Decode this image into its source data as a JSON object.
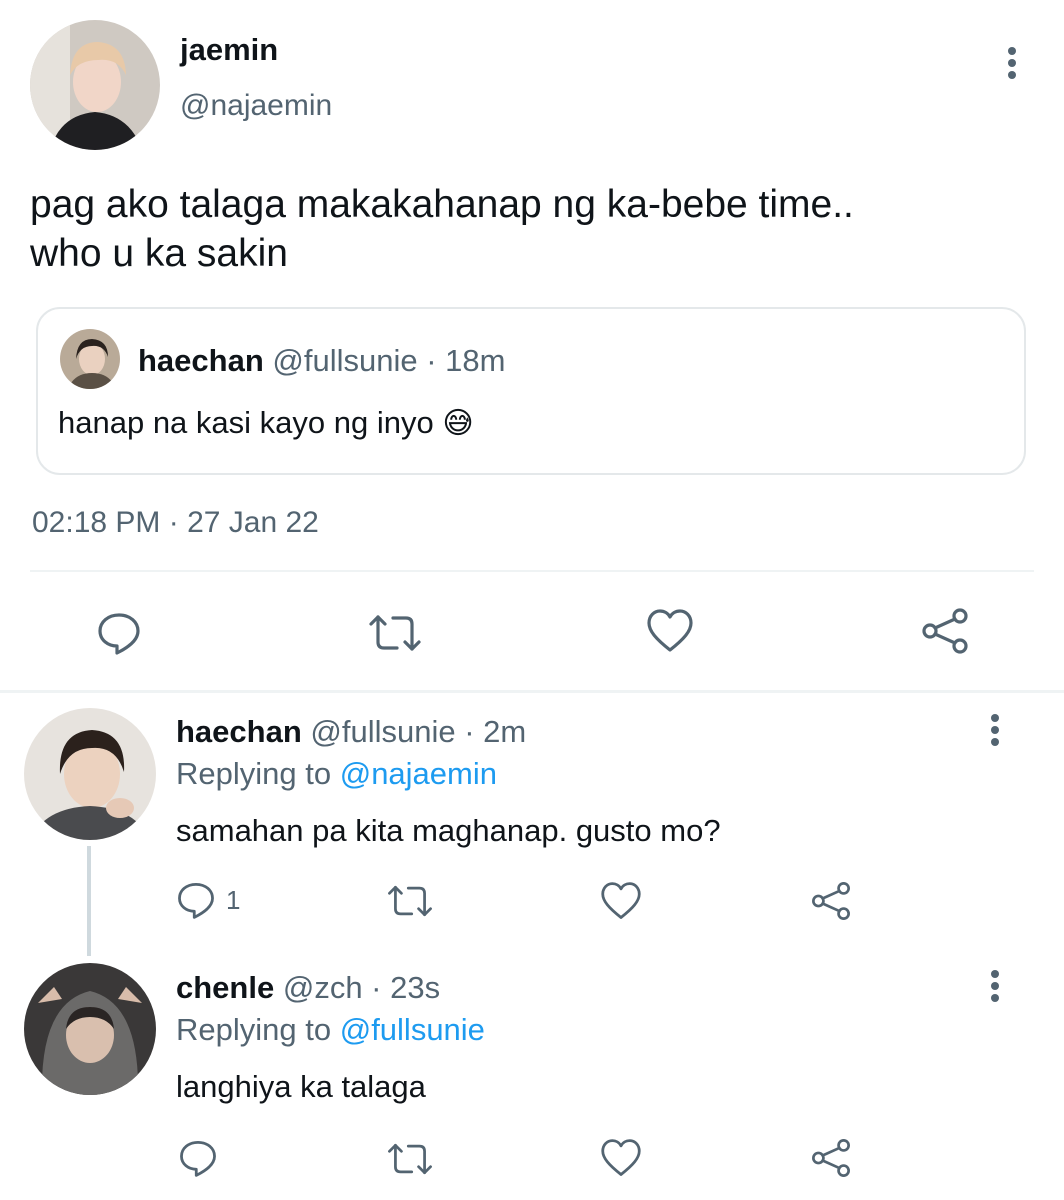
{
  "main_tweet": {
    "display_name": "jaemin",
    "handle": "@najaemin",
    "text_line1": "pag ako talaga makakahanap ng ka-bebe time..",
    "text_line2": "who u ka sakin",
    "quoted": {
      "display_name": "haechan",
      "handle_time": "@fullsunie · 18m",
      "text": "hanap na kasi kayo ng inyo",
      "emoji": "😅"
    },
    "timestamp": "02:18 PM · 27 Jan 22"
  },
  "replies": [
    {
      "display_name": "haechan",
      "handle_time": "@fullsunie · 2m",
      "replying_prefix": "Replying to ",
      "replying_to": "@najaemin",
      "text": "samahan pa kita maghanap. gusto mo?",
      "reply_count": "1"
    },
    {
      "display_name": "chenle",
      "handle_time": "@zch · 23s",
      "replying_prefix": "Replying to ",
      "replying_to": "@fullsunie",
      "text": "langhiya ka talaga",
      "reply_count": ""
    }
  ],
  "icons": {
    "reply": "reply-icon",
    "retweet": "retweet-icon",
    "like": "heart-icon",
    "share": "share-icon",
    "more": "more-options-icon"
  },
  "colors": {
    "link": "#1d9bf0",
    "muted": "#536471",
    "text": "#0f1419",
    "divider": "#eff3f4"
  }
}
